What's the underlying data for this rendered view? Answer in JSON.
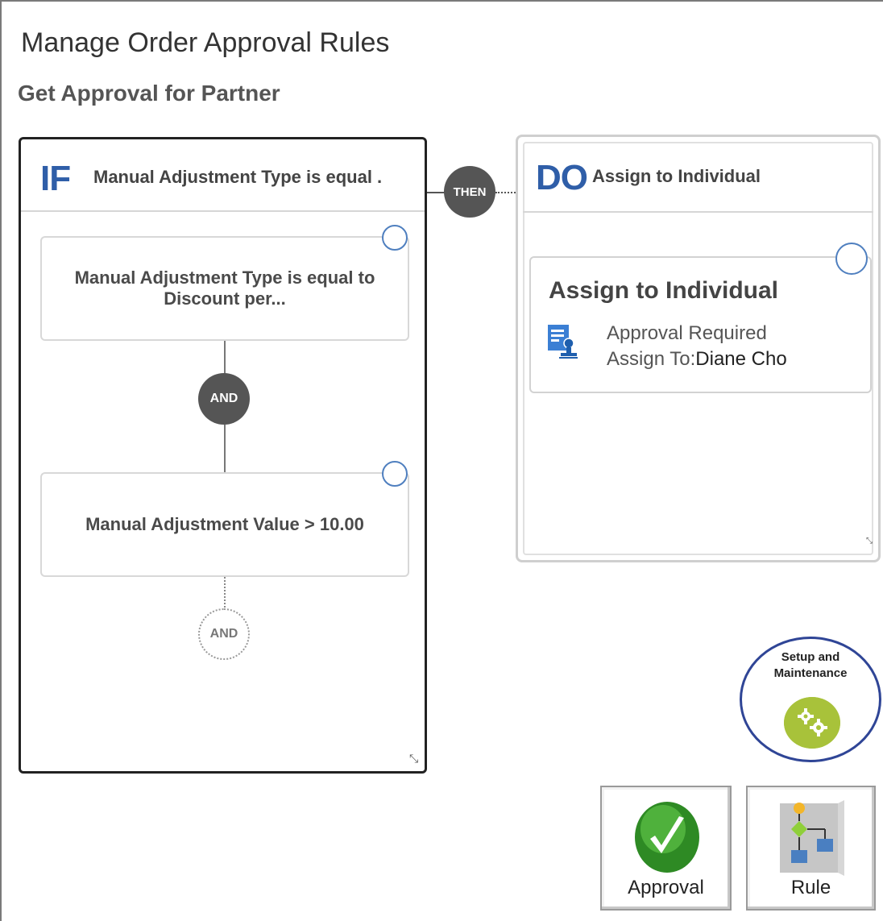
{
  "page": {
    "title": "Manage Order Approval Rules",
    "rule_name": "Get Approval for Partner"
  },
  "if_panel": {
    "keyword": "IF",
    "summary": "Manual Adjustment Type is equal .",
    "conditions": [
      {
        "text_line1": "Manual Adjustment Type is equal to",
        "text_line2": "Discount per..."
      },
      {
        "text_line1": "Manual Adjustment Value > 10.00",
        "text_line2": ""
      }
    ],
    "connector_label": "AND",
    "add_connector_label": "AND"
  },
  "then_connector": {
    "label": "THEN"
  },
  "do_panel": {
    "keyword": "DO",
    "summary": "Assign to Individual",
    "action": {
      "title": "Assign to Individual",
      "line1": "Approval Required",
      "assign_label": "Assign To:",
      "assign_value": "Diane Cho",
      "icon": "document-stamp-icon"
    }
  },
  "setup": {
    "label_line1": "Setup and",
    "label_line2": "Maintenance",
    "icon": "gears-icon",
    "accent": "#a8c23a",
    "border": "#2f4596"
  },
  "tiles": [
    {
      "label": "Approval",
      "icon": "checkmark-icon",
      "color": "#3a8f2a"
    },
    {
      "label": "Rule",
      "icon": "flowchart-icon",
      "color": "#4a7fc1"
    }
  ],
  "colors": {
    "keyword": "#2f5ea8",
    "node": "#555555",
    "circle": "#4f7fbf"
  }
}
